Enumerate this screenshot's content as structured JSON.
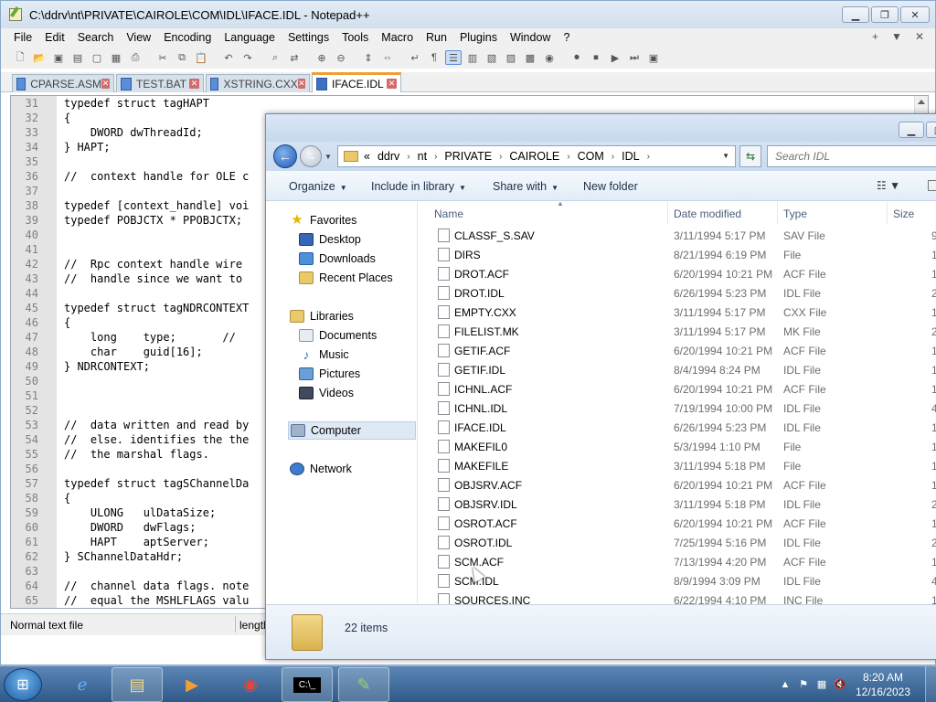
{
  "notepad": {
    "title": "C:\\ddrv\\nt\\PRIVATE\\CAIROLE\\COM\\IDL\\IFACE.IDL - Notepad++",
    "menu": [
      "File",
      "Edit",
      "Search",
      "View",
      "Encoding",
      "Language",
      "Settings",
      "Tools",
      "Macro",
      "Run",
      "Plugins",
      "Window",
      "?"
    ],
    "menu_right": [
      "+",
      "▼",
      "✕"
    ],
    "tabs": [
      {
        "label": "CPARSE.ASM"
      },
      {
        "label": "TEST.BAT"
      },
      {
        "label": "XSTRING.CXX"
      },
      {
        "label": "IFACE.IDL"
      }
    ],
    "tab_close": "✕",
    "code": [
      {
        "n": "31",
        "t": "typedef struct tagHAPT"
      },
      {
        "n": "32",
        "t": "{"
      },
      {
        "n": "33",
        "t": "    DWORD dwThreadId;"
      },
      {
        "n": "34",
        "t": "} HAPT;"
      },
      {
        "n": "35",
        "t": ""
      },
      {
        "n": "36",
        "t": "//  context handle for OLE c"
      },
      {
        "n": "37",
        "t": ""
      },
      {
        "n": "38",
        "t": "typedef [context_handle] voi"
      },
      {
        "n": "39",
        "t": "typedef POBJCTX * PPOBJCTX;"
      },
      {
        "n": "40",
        "t": ""
      },
      {
        "n": "41",
        "t": ""
      },
      {
        "n": "42",
        "t": "//  Rpc context handle wire"
      },
      {
        "n": "43",
        "t": "//  handle since we want to"
      },
      {
        "n": "44",
        "t": ""
      },
      {
        "n": "45",
        "t": "typedef struct tagNDRCONTEXT"
      },
      {
        "n": "46",
        "t": "{"
      },
      {
        "n": "47",
        "t": "    long    type;       //"
      },
      {
        "n": "48",
        "t": "    char    guid[16];"
      },
      {
        "n": "49",
        "t": "} NDRCONTEXT;"
      },
      {
        "n": "50",
        "t": ""
      },
      {
        "n": "51",
        "t": ""
      },
      {
        "n": "52",
        "t": ""
      },
      {
        "n": "53",
        "t": "//  data written and read by"
      },
      {
        "n": "54",
        "t": "//  else. identifies the the"
      },
      {
        "n": "55",
        "t": "//  the marshal flags."
      },
      {
        "n": "56",
        "t": ""
      },
      {
        "n": "57",
        "t": "typedef struct tagSChannelDa"
      },
      {
        "n": "58",
        "t": "{"
      },
      {
        "n": "59",
        "t": "    ULONG   ulDataSize;"
      },
      {
        "n": "60",
        "t": "    DWORD   dwFlags;"
      },
      {
        "n": "61",
        "t": "    HAPT    aptServer;"
      },
      {
        "n": "62",
        "t": "} SChannelDataHdr;"
      },
      {
        "n": "63",
        "t": ""
      },
      {
        "n": "64",
        "t": "//  channel data flags. note"
      },
      {
        "n": "65",
        "t": "//  equal the MSHLFLAGS valu"
      }
    ],
    "status": {
      "left": "Normal text file",
      "right": "length"
    }
  },
  "explorer": {
    "breadcrumb": [
      "«",
      "ddrv",
      "nt",
      "PRIVATE",
      "CAIROLE",
      "COM",
      "IDL"
    ],
    "search_placeholder": "Search IDL",
    "commands": {
      "organize": "Organize",
      "include": "Include in library",
      "share": "Share with",
      "new_folder": "New folder"
    },
    "nav": {
      "favorites": "Favorites",
      "desktop": "Desktop",
      "downloads": "Downloads",
      "recent": "Recent Places",
      "libraries": "Libraries",
      "documents": "Documents",
      "music": "Music",
      "pictures": "Pictures",
      "videos": "Videos",
      "computer": "Computer",
      "network": "Network"
    },
    "columns": {
      "name": "Name",
      "date": "Date modified",
      "type": "Type",
      "size": "Size"
    },
    "files": [
      {
        "name": "CLASSF_S.SAV",
        "date": "3/11/1994 5:17 PM",
        "type": "SAV File",
        "size": "9"
      },
      {
        "name": "DIRS",
        "date": "8/21/1994 6:19 PM",
        "type": "File",
        "size": "1"
      },
      {
        "name": "DROT.ACF",
        "date": "6/20/1994 10:21 PM",
        "type": "ACF File",
        "size": "1"
      },
      {
        "name": "DROT.IDL",
        "date": "6/26/1994 5:23 PM",
        "type": "IDL File",
        "size": "2"
      },
      {
        "name": "EMPTY.CXX",
        "date": "3/11/1994 5:17 PM",
        "type": "CXX File",
        "size": "1"
      },
      {
        "name": "FILELIST.MK",
        "date": "3/11/1994 5:17 PM",
        "type": "MK File",
        "size": "2"
      },
      {
        "name": "GETIF.ACF",
        "date": "6/20/1994 10:21 PM",
        "type": "ACF File",
        "size": "1"
      },
      {
        "name": "GETIF.IDL",
        "date": "8/4/1994 8:24 PM",
        "type": "IDL File",
        "size": "1"
      },
      {
        "name": "ICHNL.ACF",
        "date": "6/20/1994 10:21 PM",
        "type": "ACF File",
        "size": "1"
      },
      {
        "name": "ICHNL.IDL",
        "date": "7/19/1994 10:00 PM",
        "type": "IDL File",
        "size": "4"
      },
      {
        "name": "IFACE.IDL",
        "date": "6/26/1994 5:23 PM",
        "type": "IDL File",
        "size": "1"
      },
      {
        "name": "MAKEFIL0",
        "date": "5/3/1994 1:10 PM",
        "type": "File",
        "size": "1"
      },
      {
        "name": "MAKEFILE",
        "date": "3/11/1994 5:18 PM",
        "type": "File",
        "size": "1"
      },
      {
        "name": "OBJSRV.ACF",
        "date": "6/20/1994 10:21 PM",
        "type": "ACF File",
        "size": "1"
      },
      {
        "name": "OBJSRV.IDL",
        "date": "3/11/1994 5:18 PM",
        "type": "IDL File",
        "size": "2"
      },
      {
        "name": "OSROT.ACF",
        "date": "6/20/1994 10:21 PM",
        "type": "ACF File",
        "size": "1"
      },
      {
        "name": "OSROT.IDL",
        "date": "7/25/1994 5:16 PM",
        "type": "IDL File",
        "size": "2"
      },
      {
        "name": "SCM.ACF",
        "date": "7/13/1994 4:20 PM",
        "type": "ACF File",
        "size": "1"
      },
      {
        "name": "SCM.IDL",
        "date": "8/9/1994 3:09 PM",
        "type": "IDL File",
        "size": "4"
      },
      {
        "name": "SOURCES.INC",
        "date": "6/22/1994 4:10 PM",
        "type": "INC File",
        "size": "1"
      }
    ],
    "items_count": "22 items"
  },
  "taskbar": {
    "time": "8:20 AM",
    "date": "12/16/2023"
  }
}
